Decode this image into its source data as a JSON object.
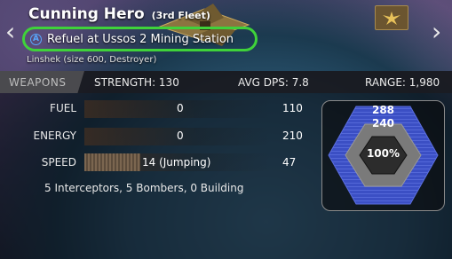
{
  "header": {
    "ship_name": "Cunning Hero",
    "fleet": "(3rd Fleet)",
    "order_icon": "A",
    "order_text": "Refuel at Ussos 2 Mining Station",
    "subtitle": "Linshek (size 600, Destroyer)"
  },
  "stats": {
    "tab_label": "WEAPONS",
    "strength": "STRENGTH: 130",
    "avg_dps": "AVG DPS: 7.8",
    "range": "RANGE: 1,980"
  },
  "resources": [
    {
      "label": "FUEL",
      "value": "0",
      "max": "110",
      "fraction": 0
    },
    {
      "label": "ENERGY",
      "value": "0",
      "max": "210",
      "fraction": 0
    },
    {
      "label": "SPEED",
      "value": "14 (Jumping)",
      "max": "47",
      "fraction": 0.3
    }
  ],
  "craft": "5 Interceptors, 5 Bombers, 0 Building",
  "defense": {
    "shields": "288",
    "armor": "240",
    "hull": "100%"
  },
  "colors": {
    "highlight_ring": "#3fd23a",
    "shield_blue": "#3b4fc4",
    "armor_gray": "#777777",
    "hull_dark": "#2c2c2c"
  }
}
